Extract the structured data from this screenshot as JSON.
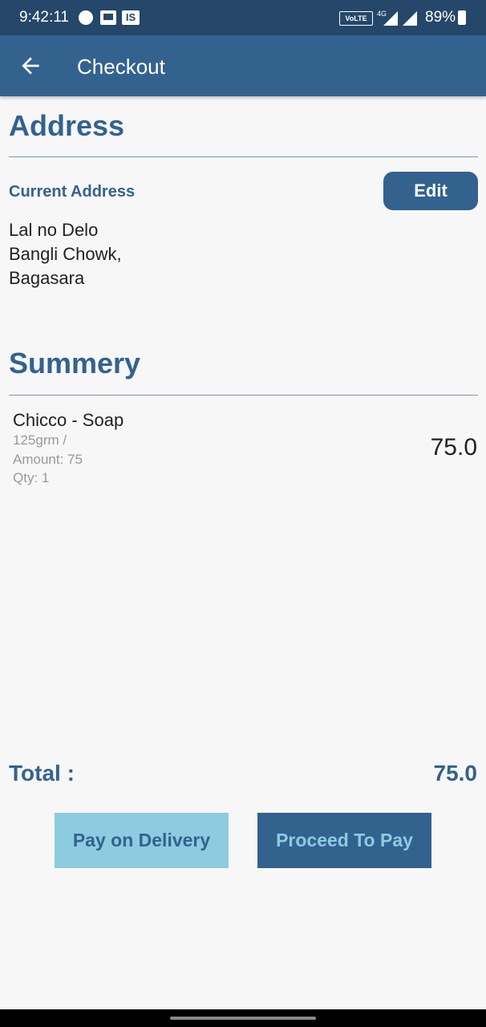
{
  "status": {
    "time": "9:42:11",
    "is_badge": "IS",
    "volte": "VoLTE",
    "network": "4G",
    "battery": "89%"
  },
  "appbar": {
    "title": "Checkout",
    "back_icon": "arrow-back-icon"
  },
  "address": {
    "heading": "Address",
    "label": "Current Address",
    "edit_label": "Edit",
    "lines": [
      "Lal no Delo",
      "Bangli Chowk,",
      "Bagasara"
    ]
  },
  "summary": {
    "heading": "Summery",
    "item": {
      "name": "Chicco - Soap",
      "weight": "125grm /",
      "amount": "Amount: 75",
      "qty": "Qty: 1",
      "price": "75.0"
    }
  },
  "total": {
    "label": "Total :",
    "value": "75.0"
  },
  "buttons": {
    "pay_on_delivery": "Pay on Delivery",
    "proceed_to_pay": "Proceed To Pay"
  },
  "colors": {
    "primary": "#33628f",
    "status_bar": "#24476a",
    "accent_light": "#8ccbe0",
    "background": "#f7f7f7"
  }
}
